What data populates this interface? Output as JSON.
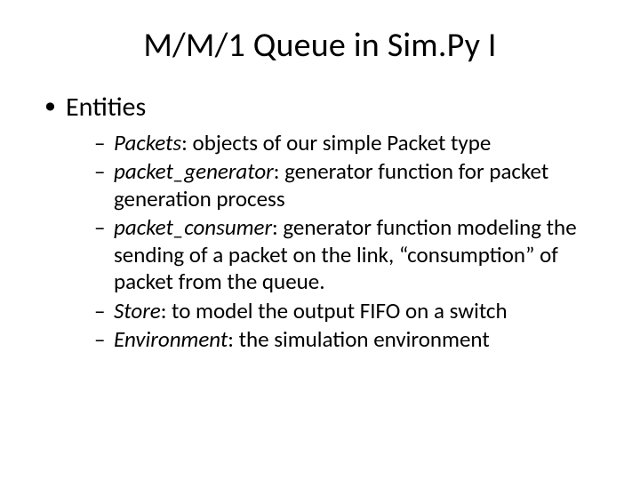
{
  "title": "M/M/1 Queue in Sim.Py I",
  "section": "Entities",
  "items": [
    {
      "term": "Packets",
      "desc": ": objects of our simple Packet type"
    },
    {
      "term": "packet_generator",
      "desc": ": generator function for packet generation process"
    },
    {
      "term": "packet_consumer",
      "desc": ": generator function modeling the sending of a packet on the link, “consumption” of packet from the queue."
    },
    {
      "term": "Store",
      "desc": ": to model the output FIFO on a switch"
    },
    {
      "term": "Environment",
      "desc": ": the simulation environment"
    }
  ]
}
